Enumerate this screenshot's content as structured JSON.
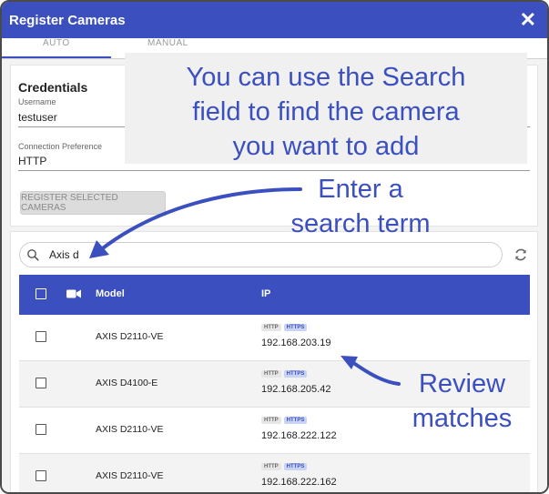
{
  "dialog": {
    "title": "Register Cameras",
    "close_symbol": "✕"
  },
  "tabs": [
    {
      "label": "AUTO",
      "active": true
    },
    {
      "label": "MANUAL",
      "active": false
    }
  ],
  "credentials": {
    "title": "Credentials",
    "username_label": "Username",
    "username_value": "testuser",
    "connection_label": "Connection Preference",
    "connection_value": "HTTP",
    "register_button": "REGISTER SELECTED CAMERAS"
  },
  "search": {
    "value": "Axis d",
    "icon": "search-icon"
  },
  "table": {
    "headers": {
      "camera_icon": "video-camera-icon",
      "model": "Model",
      "ip": "IP"
    },
    "rows": [
      {
        "model": "AXIS D2110-VE",
        "badges": [
          "HTTP",
          "HTTPS"
        ],
        "ip": "192.168.203.19"
      },
      {
        "model": "AXIS D4100-E",
        "badges": [
          "HTTP",
          "HTTPS"
        ],
        "ip": "192.168.205.42"
      },
      {
        "model": "AXIS D2110-VE",
        "badges": [
          "HTTP",
          "HTTPS"
        ],
        "ip": "192.168.222.122"
      },
      {
        "model": "AXIS D2110-VE",
        "badges": [
          "HTTP",
          "HTTPS"
        ],
        "ip": "192.168.222.162"
      }
    ]
  },
  "annotations": {
    "callout_lines": [
      "You can use the Search",
      "field to find the camera",
      "you want to add"
    ],
    "enter_lines": [
      "Enter a",
      "search term"
    ],
    "review_lines": [
      "Review",
      "matches"
    ]
  },
  "colors": {
    "brand": "#3b4fbf",
    "callout_bg": "#f0f0f0",
    "http_badge": "#e6e6e6",
    "https_badge": "#c9d3f3"
  }
}
